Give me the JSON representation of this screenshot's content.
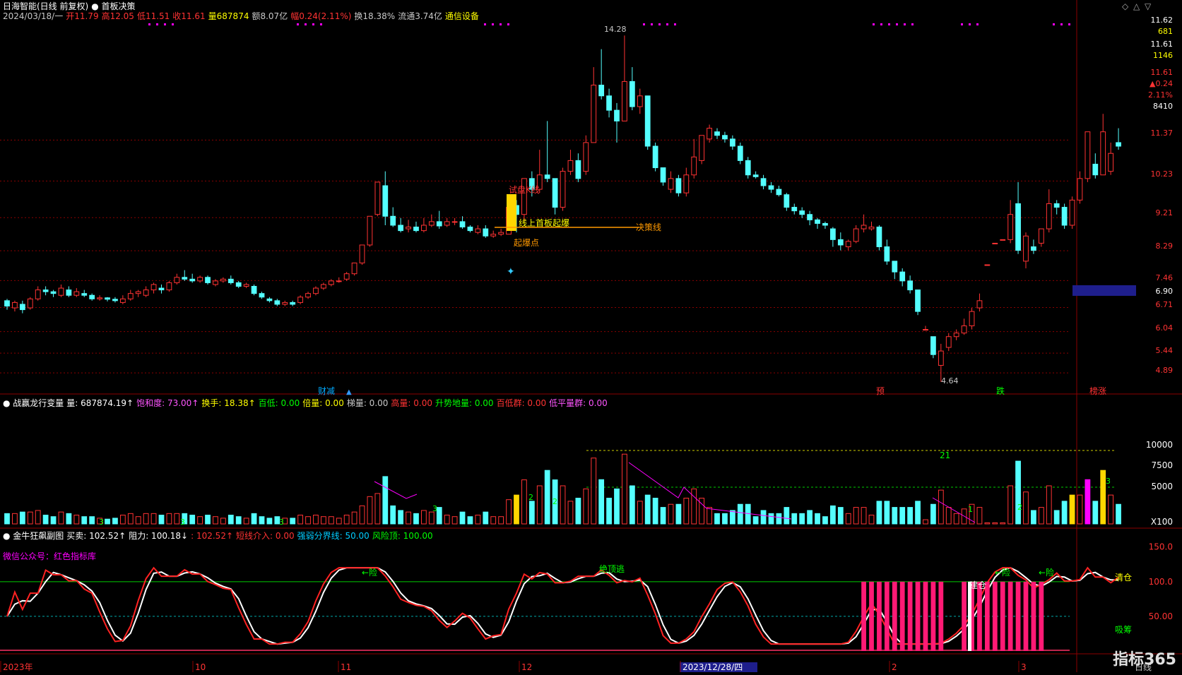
{
  "main_header": {
    "line1": [
      {
        "text": "日海智能(日线 前复权)",
        "color": "#ffffff"
      },
      {
        "text": "● 首板决策",
        "color": "#ffffff"
      }
    ],
    "line2": [
      {
        "text": "2024/03/18/一",
        "color": "#c8c8c8"
      },
      {
        "text": "开11.79",
        "color": "#ff3333"
      },
      {
        "text": "高12.05",
        "color": "#ff3333"
      },
      {
        "text": "低11.51",
        "color": "#ff3333"
      },
      {
        "text": "收11.61",
        "color": "#ff3333"
      },
      {
        "text": "量687874",
        "color": "#ffff00"
      },
      {
        "text": "额8.07亿",
        "color": "#c8c8c8"
      },
      {
        "text": "幅0.24(2.11%)",
        "color": "#ff3333"
      },
      {
        "text": "换18.38%",
        "color": "#c8c8c8"
      },
      {
        "text": "流通3.74亿",
        "color": "#c8c8c8"
      },
      {
        "text": "通信设备",
        "color": "#ffff00"
      }
    ]
  },
  "window_controls": [
    "◇",
    "△",
    "▽"
  ],
  "right_axis_main": {
    "labels": [
      {
        "text": "11.62",
        "color": "#ffffff"
      },
      {
        "text": "681",
        "color": "#ffff00"
      },
      {
        "text": "11.61",
        "color": "#ffffff"
      },
      {
        "text": "1146",
        "color": "#ffff00"
      },
      {
        "text": "11.61",
        "color": "#ff3333"
      },
      {
        "text": "▲0.24",
        "color": "#ff3333"
      },
      {
        "text": "2.11%",
        "color": "#ff3333"
      },
      {
        "text": "8410",
        "color": "#ffffff"
      },
      {
        "text": "11.37",
        "color": "#ff3333"
      },
      {
        "text": "10.23",
        "color": "#ff3333"
      },
      {
        "text": "9.21",
        "color": "#ff3333"
      },
      {
        "text": "8.29",
        "color": "#ff3333"
      },
      {
        "text": "7.46",
        "color": "#ff3333"
      },
      {
        "text": "6.90",
        "color": "#ffffff"
      },
      {
        "text": "6.71",
        "color": "#ff3333"
      },
      {
        "text": "6.04",
        "color": "#ff3333"
      },
      {
        "text": "5.44",
        "color": "#ff3333"
      },
      {
        "text": "4.89",
        "color": "#ff3333"
      }
    ]
  },
  "annotations_main": {
    "high_label": "14.28",
    "low_label": "4.64",
    "trial_k": "试盘K线",
    "first_board": "线上首板起爆",
    "decision_line": "决策线",
    "launch_point": "起爆点"
  },
  "bottom_tags": [
    {
      "text": "财减",
      "color": "#00aaff"
    },
    {
      "text": "预",
      "color": "#ff3333"
    },
    {
      "text": "跌",
      "color": "#00ff00"
    },
    {
      "text": "榜涨",
      "color": "#ff3333"
    }
  ],
  "vol_header": [
    {
      "text": "● 战赢龙行变量",
      "color": "#ffffff"
    },
    {
      "text": "量: 687874.19↑",
      "color": "#ffffff"
    },
    {
      "text": "饱和度: 73.00↑",
      "color": "#ff55ff"
    },
    {
      "text": "换手: 18.38↑",
      "color": "#ffff00"
    },
    {
      "text": "百低: 0.00",
      "color": "#00ff00"
    },
    {
      "text": "倍量: 0.00",
      "color": "#ffff00"
    },
    {
      "text": "梯量: 0.00",
      "color": "#c8c8c8"
    },
    {
      "text": "高量: 0.00",
      "color": "#ff3333"
    },
    {
      "text": "升势地量: 0.00",
      "color": "#00ff00"
    },
    {
      "text": "百低群: 0.00",
      "color": "#ff3333"
    },
    {
      "text": "低平量群: 0.00",
      "color": "#ff55ff"
    }
  ],
  "vol_axis": {
    "labels": [
      {
        "text": "10000",
        "color": "#ffffff"
      },
      {
        "text": "7500",
        "color": "#ffffff"
      },
      {
        "text": "5000",
        "color": "#ffffff"
      },
      {
        "text": "X100",
        "color": "#ffffff"
      }
    ]
  },
  "vol_annotations": {
    "count_21": "21",
    "small_counts": [
      "3",
      "2",
      "2",
      "3",
      "3",
      "3",
      "1",
      "2",
      "3"
    ]
  },
  "osc_header": [
    {
      "text": "● 金牛狂飙副图",
      "color": "#ffffff"
    },
    {
      "text": "买卖: 102.52↑",
      "color": "#ffffff"
    },
    {
      "text": "阻力: 100.18↓",
      "color": "#ffffff"
    },
    {
      "text": ": 102.52↑",
      "color": "#ff3333"
    },
    {
      "text": "短线介入: 0.00",
      "color": "#ff3333"
    },
    {
      "text": "强弱分界线: 50.00",
      "color": "#00ccff"
    },
    {
      "text": "风险顶: 100.00",
      "color": "#00ff00"
    }
  ],
  "osc_watermark": "微信公众号：红色指标库",
  "osc_axis": {
    "labels": [
      {
        "text": "150.0",
        "color": "#ff3333"
      },
      {
        "text": "100.0",
        "color": "#ff3333"
      },
      {
        "text": "50.00",
        "color": "#ff3333"
      }
    ]
  },
  "osc_annotations": {
    "risk": "←险",
    "top_escape": "绝顶逃",
    "build": "建仓",
    "clear": "清仓",
    "absorb": "吸筹"
  },
  "date_axis": [
    {
      "text": "2023年",
      "color": "#ff3333"
    },
    {
      "text": "10",
      "color": "#ff3333"
    },
    {
      "text": "11",
      "color": "#ff3333"
    },
    {
      "text": "12",
      "color": "#ff3333"
    },
    {
      "text": "2023/12/28/四",
      "color": "#ffffff"
    },
    {
      "text": "2",
      "color": "#ff3333"
    },
    {
      "text": "3",
      "color": "#ff3333"
    }
  ],
  "period_label": "日线",
  "brand": "指标365",
  "colors": {
    "up": "#ff3333",
    "down": "#54ffff",
    "grid": "#8b0000",
    "bg": "#000000"
  },
  "chart_data": [
    {
      "type": "candlestick",
      "title": "日海智能(日线 前复权)",
      "ylim": [
        4.5,
        14.6
      ],
      "ticks": [
        4.89,
        5.44,
        6.04,
        6.71,
        7.46,
        8.29,
        9.21,
        10.23,
        11.37
      ],
      "ohlc": [
        [
          6.9,
          6.75,
          6.95,
          6.65
        ],
        [
          6.7,
          6.85,
          6.9,
          6.6
        ],
        [
          6.8,
          6.65,
          6.9,
          6.55
        ],
        [
          6.7,
          6.95,
          7.0,
          6.65
        ],
        [
          6.95,
          7.2,
          7.3,
          6.9
        ],
        [
          7.2,
          7.15,
          7.3,
          7.05
        ],
        [
          7.15,
          7.1,
          7.2,
          7.0
        ],
        [
          7.05,
          7.25,
          7.35,
          7.0
        ],
        [
          7.2,
          7.05,
          7.3,
          7.0
        ],
        [
          7.05,
          7.15,
          7.25,
          7.0
        ],
        [
          7.1,
          7.05,
          7.2,
          7.0
        ],
        [
          7.05,
          6.95,
          7.1,
          6.9
        ],
        [
          6.95,
          6.98,
          7.05,
          6.9
        ],
        [
          6.98,
          6.94,
          7.0,
          6.88
        ],
        [
          6.94,
          6.9,
          7.0,
          6.85
        ],
        [
          6.85,
          6.95,
          7.05,
          6.8
        ],
        [
          6.95,
          7.1,
          7.2,
          6.9
        ],
        [
          7.1,
          7.15,
          7.2,
          7.0
        ],
        [
          7.05,
          7.2,
          7.3,
          7.0
        ],
        [
          7.2,
          7.35,
          7.4,
          7.1
        ],
        [
          7.25,
          7.2,
          7.35,
          7.1
        ],
        [
          7.2,
          7.4,
          7.45,
          7.15
        ],
        [
          7.4,
          7.55,
          7.65,
          7.35
        ],
        [
          7.55,
          7.5,
          7.75,
          7.45
        ],
        [
          7.5,
          7.45,
          7.65,
          7.4
        ],
        [
          7.45,
          7.55,
          7.6,
          7.4
        ],
        [
          7.55,
          7.4,
          7.6,
          7.35
        ],
        [
          7.35,
          7.45,
          7.5,
          7.3
        ],
        [
          7.45,
          7.5,
          7.55,
          7.4
        ],
        [
          7.5,
          7.4,
          7.6,
          7.35
        ],
        [
          7.4,
          7.3,
          7.45,
          7.25
        ],
        [
          7.3,
          7.35,
          7.4,
          7.25
        ],
        [
          7.3,
          7.1,
          7.35,
          7.05
        ],
        [
          7.1,
          7.0,
          7.15,
          6.95
        ],
        [
          6.95,
          6.9,
          7.0,
          6.85
        ],
        [
          6.9,
          6.8,
          6.95,
          6.75
        ],
        [
          6.8,
          6.85,
          6.9,
          6.75
        ],
        [
          6.85,
          6.8,
          6.9,
          6.75
        ],
        [
          6.85,
          7.0,
          7.05,
          6.8
        ],
        [
          7.0,
          7.1,
          7.15,
          6.95
        ],
        [
          7.1,
          7.25,
          7.3,
          7.05
        ],
        [
          7.25,
          7.35,
          7.4,
          7.2
        ],
        [
          7.35,
          7.45,
          7.5,
          7.3
        ],
        [
          7.45,
          7.45,
          7.55,
          7.4
        ],
        [
          7.5,
          7.65,
          7.7,
          7.45
        ],
        [
          7.65,
          7.95,
          7.95,
          7.6
        ],
        [
          7.95,
          8.45,
          8.45,
          7.9
        ],
        [
          8.45,
          9.25,
          9.25,
          8.4
        ],
        [
          9.3,
          10.2,
          10.2,
          9.25
        ],
        [
          10.1,
          9.25,
          10.5,
          9.0
        ],
        [
          9.25,
          9.0,
          9.5,
          8.95
        ],
        [
          9.0,
          8.85,
          9.2,
          8.8
        ],
        [
          8.9,
          8.95,
          9.15,
          8.8
        ],
        [
          8.95,
          8.85,
          9.1,
          8.8
        ],
        [
          8.85,
          9.0,
          9.2,
          8.8
        ],
        [
          9.0,
          9.1,
          9.3,
          8.95
        ],
        [
          9.1,
          8.98,
          9.4,
          8.9
        ],
        [
          9.0,
          9.1,
          9.2,
          8.95
        ],
        [
          9.1,
          9.1,
          9.2,
          9.0
        ],
        [
          9.1,
          8.95,
          9.25,
          8.9
        ],
        [
          8.95,
          8.85,
          9.0,
          8.8
        ],
        [
          8.8,
          8.9,
          9.0,
          8.75
        ],
        [
          8.9,
          8.7,
          9.0,
          8.65
        ],
        [
          8.7,
          8.75,
          8.85,
          8.65
        ],
        [
          8.75,
          8.8,
          8.9,
          8.7
        ],
        [
          8.75,
          9.5,
          9.5,
          8.75
        ],
        [
          9.55,
          9.3,
          9.7,
          8.8
        ],
        [
          9.3,
          10.3,
          10.3,
          9.1
        ],
        [
          10.3,
          10.0,
          10.5,
          9.8
        ],
        [
          10.0,
          10.4,
          11.1,
          9.9
        ],
        [
          10.4,
          10.3,
          11.9,
          10.2
        ],
        [
          10.3,
          9.5,
          9.9,
          9.3
        ],
        [
          9.5,
          10.5,
          10.6,
          9.4
        ],
        [
          10.5,
          10.8,
          11.1,
          10.4
        ],
        [
          10.8,
          10.3,
          11.0,
          10.2
        ],
        [
          10.5,
          11.3,
          11.5,
          10.4
        ],
        [
          11.3,
          12.9,
          13.4,
          11.3
        ],
        [
          12.9,
          12.6,
          13.9,
          12.5
        ],
        [
          12.6,
          12.2,
          12.8,
          12.0
        ],
        [
          12.2,
          11.9,
          12.4,
          11.3
        ],
        [
          11.9,
          13.0,
          14.28,
          11.9
        ],
        [
          13.0,
          12.3,
          13.4,
          12.2
        ],
        [
          12.3,
          12.6,
          12.8,
          12.1
        ],
        [
          12.6,
          11.2,
          12.0,
          11.1
        ],
        [
          11.2,
          10.6,
          11.3,
          10.5
        ],
        [
          10.6,
          10.2,
          10.6,
          10.1
        ],
        [
          10.0,
          10.3,
          10.5,
          9.9
        ],
        [
          10.3,
          9.9,
          10.4,
          9.8
        ],
        [
          9.9,
          10.4,
          10.6,
          9.8
        ],
        [
          10.4,
          10.9,
          11.4,
          10.3
        ],
        [
          10.8,
          11.5,
          11.5,
          10.7
        ],
        [
          11.4,
          11.7,
          11.8,
          11.3
        ],
        [
          11.6,
          11.5,
          11.7,
          11.4
        ],
        [
          11.5,
          11.4,
          11.6,
          11.3
        ],
        [
          11.4,
          11.2,
          11.5,
          11.1
        ],
        [
          11.2,
          10.8,
          11.3,
          10.7
        ],
        [
          10.8,
          10.4,
          10.9,
          10.3
        ],
        [
          10.4,
          10.35,
          10.5,
          10.3
        ],
        [
          10.3,
          10.1,
          10.4,
          10.0
        ],
        [
          10.1,
          10.0,
          10.2,
          9.9
        ],
        [
          10.0,
          9.85,
          10.1,
          9.8
        ],
        [
          9.85,
          9.5,
          9.9,
          9.4
        ],
        [
          9.5,
          9.4,
          9.6,
          9.3
        ],
        [
          9.4,
          9.3,
          9.5,
          9.2
        ],
        [
          9.3,
          9.15,
          9.4,
          9.0
        ],
        [
          9.15,
          9.05,
          9.2,
          8.9
        ],
        [
          9.05,
          9.0,
          9.1,
          8.9
        ],
        [
          8.9,
          8.6,
          8.95,
          8.4
        ],
        [
          8.6,
          8.45,
          8.8,
          8.3
        ],
        [
          8.4,
          8.55,
          8.6,
          8.3
        ],
        [
          8.55,
          8.9,
          9.0,
          8.5
        ],
        [
          8.9,
          9.0,
          9.3,
          8.8
        ],
        [
          8.9,
          8.95,
          9.1,
          8.85
        ],
        [
          8.95,
          8.4,
          9.0,
          8.3
        ],
        [
          8.4,
          8.0,
          8.6,
          7.9
        ],
        [
          8.0,
          7.7,
          8.0,
          7.5
        ],
        [
          7.7,
          7.45,
          7.8,
          7.3
        ],
        [
          7.45,
          7.2,
          7.6,
          7.1
        ],
        [
          7.2,
          6.6,
          7.2,
          6.5
        ],
        [
          6.1,
          6.1,
          6.2,
          6.1
        ],
        [
          5.9,
          5.4,
          5.9,
          5.3
        ],
        [
          5.1,
          5.5,
          5.7,
          4.64
        ],
        [
          5.6,
          5.9,
          6.0,
          5.5
        ],
        [
          5.9,
          6.0,
          6.1,
          5.8
        ],
        [
          6.0,
          6.2,
          6.4,
          5.95
        ],
        [
          6.2,
          6.6,
          6.7,
          6.1
        ],
        [
          6.7,
          6.9,
          7.1,
          6.6
        ],
        [
          7.9,
          7.9,
          7.9,
          7.9
        ],
        [
          8.5,
          8.5,
          8.5,
          8.5
        ],
        [
          8.6,
          8.6,
          8.6,
          8.6
        ],
        [
          8.6,
          9.3,
          9.7,
          8.5
        ],
        [
          9.6,
          8.3,
          10.2,
          8.2
        ],
        [
          8.0,
          8.7,
          8.8,
          7.8
        ],
        [
          8.4,
          8.3,
          8.6,
          8.2
        ],
        [
          8.5,
          8.9,
          8.9,
          8.4
        ],
        [
          8.9,
          9.6,
          10.0,
          8.8
        ],
        [
          9.6,
          9.5,
          9.7,
          9.3
        ],
        [
          9.5,
          9.0,
          9.6,
          8.9
        ],
        [
          9.0,
          9.7,
          9.8,
          8.9
        ],
        [
          9.7,
          10.3,
          10.5,
          9.6
        ],
        [
          10.3,
          11.6,
          11.6,
          10.2
        ],
        [
          10.7,
          10.4,
          11.0,
          10.3
        ],
        [
          10.4,
          11.6,
          12.1,
          10.4
        ],
        [
          10.5,
          11.0,
          11.3,
          10.4
        ],
        [
          11.3,
          11.2,
          11.7,
          11.1
        ]
      ]
    }
  ]
}
